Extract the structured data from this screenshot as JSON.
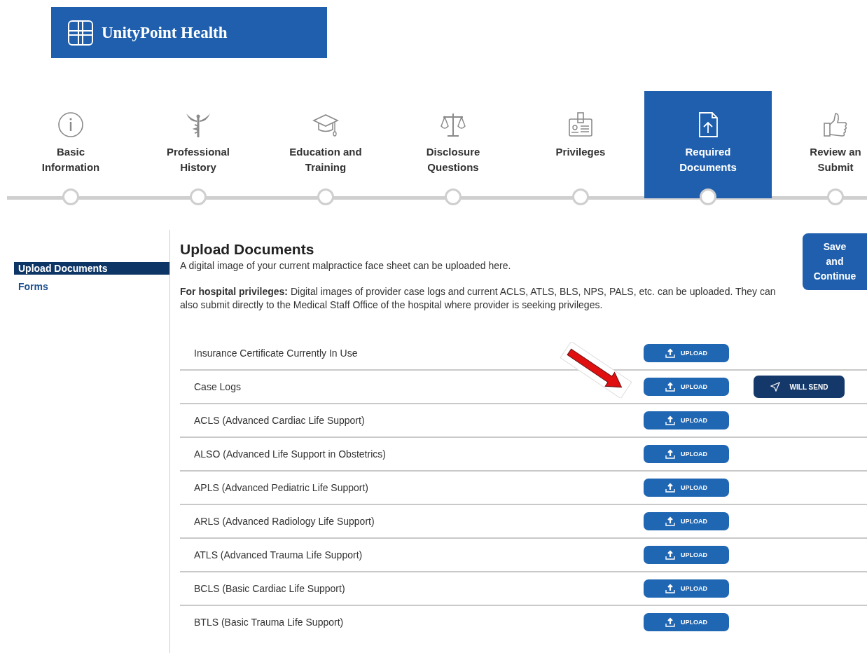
{
  "logo": {
    "text": "UnityPoint Health"
  },
  "steps": [
    {
      "label": "Basic\nInformation",
      "selected": false
    },
    {
      "label": "Professional\nHistory",
      "selected": false
    },
    {
      "label": "Education and\nTraining",
      "selected": false
    },
    {
      "label": "Disclosure\nQuestions",
      "selected": false
    },
    {
      "label": "Privileges",
      "selected": false
    },
    {
      "label": "Required\nDocuments",
      "selected": true
    },
    {
      "label": "Review an\nSubmit",
      "selected": false
    }
  ],
  "sidebar": {
    "items": [
      {
        "label": "Upload Documents",
        "selected": true
      },
      {
        "label": "Forms",
        "selected": false
      }
    ]
  },
  "content": {
    "title": "Upload Documents",
    "intro": "A digital image of your current malpractice face sheet can be uploaded here.",
    "note": "**For hospital privileges:** Digital images of provider case logs and current ACLS, ATLS, BLS, NPS, PALS, etc.  can be uploaded.  They can also submit directly to the Medical Staff Office of the hospital where provider is seeking privileges.",
    "save_button": "Save\nand\nContinue"
  },
  "documents": [
    {
      "label": "Insurance Certificate Currently In Use",
      "upload": "UPLOAD"
    },
    {
      "label": "Case Logs",
      "upload": "UPLOAD",
      "will_send": "WILL SEND"
    },
    {
      "label": "ACLS (Advanced Cardiac Life Support)",
      "upload": "UPLOAD"
    },
    {
      "label": "ALSO (Advanced Life Support in Obstetrics)",
      "upload": "UPLOAD"
    },
    {
      "label": "APLS (Advanced Pediatric Life Support)",
      "upload": "UPLOAD"
    },
    {
      "label": "ARLS (Advanced Radiology Life Support)",
      "upload": "UPLOAD"
    },
    {
      "label": "ATLS (Advanced Trauma Life Support)",
      "upload": "UPLOAD"
    },
    {
      "label": "BCLS (Basic Cardiac Life Support)",
      "upload": "UPLOAD"
    },
    {
      "label": "BTLS (Basic Trauma Life Support)",
      "upload": "UPLOAD"
    }
  ]
}
